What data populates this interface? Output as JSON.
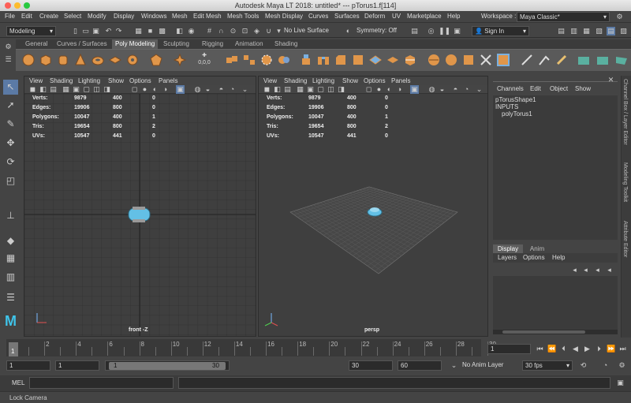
{
  "window": {
    "title": "Autodesk Maya LT 2018: untitled*   ---   pTorus1.f[114]"
  },
  "menu": [
    "File",
    "Edit",
    "Create",
    "Select",
    "Modify",
    "Display",
    "Windows",
    "Mesh",
    "Edit Mesh",
    "Mesh Tools",
    "Mesh Display",
    "Curves",
    "Surfaces",
    "Deform",
    "UV",
    "Marketplace",
    "Help"
  ],
  "workspace": {
    "label": "Workspace :",
    "value": "Maya Classic*"
  },
  "status": {
    "mode": "Modeling",
    "live": "No Live Surface",
    "symmetry": "Symmetry: Off",
    "signin": "Sign In"
  },
  "shelf_tabs": [
    "General",
    "Curves / Surfaces",
    "Poly Modeling",
    "Sculpting",
    "Rigging",
    "Animation",
    "Shading"
  ],
  "shelf_extra_label": "0,0,0",
  "viewport_menu": [
    "View",
    "Shading",
    "Lighting",
    "Show",
    "Options",
    "Panels"
  ],
  "hud": {
    "labels": [
      "Verts:",
      "Edges:",
      "Polygons:",
      "Tris:",
      "UVs:"
    ],
    "col1": [
      "9879",
      "19906",
      "10047",
      "19654",
      "10547"
    ],
    "col2": [
      "400",
      "800",
      "400",
      "800",
      "441"
    ],
    "col3": [
      "0",
      "0",
      "1",
      "2",
      "0"
    ]
  },
  "viewports": {
    "left_label": "front -Z",
    "right_label": "persp"
  },
  "channel_box": {
    "menu": [
      "Channels",
      "Edit",
      "Object",
      "Show"
    ],
    "shape": "pTorusShape1",
    "inputs": "INPUTS",
    "input_node": "polyTorus1"
  },
  "layer_panel": {
    "tabs": [
      "Display",
      "Anim"
    ],
    "menu": [
      "Layers",
      "Options",
      "Help"
    ]
  },
  "side_tabs": [
    "Channel Box / Layer Editor",
    "Modeling Toolkit",
    "Attribute Editor"
  ],
  "timeline": {
    "ticks": [
      "2",
      "4",
      "6",
      "8",
      "10",
      "12",
      "14",
      "16",
      "18",
      "20",
      "22",
      "24",
      "26",
      "28",
      "30"
    ],
    "current": "1",
    "frame_field": "1"
  },
  "range": {
    "start": "1",
    "start2": "1",
    "slider_start": "1",
    "slider_end": "30",
    "end": "30",
    "end2": "60",
    "anim_layer": "No Anim Layer",
    "fps": "30 fps"
  },
  "mel": {
    "label": "MEL"
  },
  "help": {
    "text": "Lock Camera"
  }
}
